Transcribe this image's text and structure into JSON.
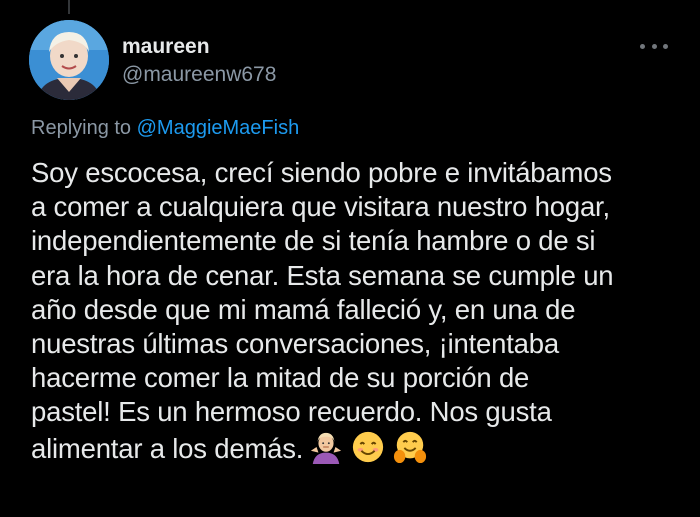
{
  "tweet": {
    "display_name": "maureen",
    "handle": "@maureenw678",
    "replying_prefix": "Replying to",
    "replying_mention": "@MaggieMaeFish",
    "text": "Soy escocesa, crecí siendo pobre e invitábamos\na comer a cualquiera que visitara nuestro hogar,\nindependientemente de si tenía hambre o de si\nera la hora de cenar. Esta semana se cumple un\naño desde que mi mamá falleció y, en una de\nnuestras últimas conversaciones, ¡intentaba\nhacerme comer la mitad de su porción de\npastel! Es un hermoso recuerdo. Nos gusta\nalimentar a los demás.",
    "emojis": [
      "person-shrugging-emoji",
      "smiling-face-emoji",
      "hugging-face-emoji"
    ]
  },
  "colors": {
    "background": "#000000",
    "text_primary": "#e7e9ea",
    "text_secondary": "#8b98a5",
    "link": "#1d9bf0"
  }
}
